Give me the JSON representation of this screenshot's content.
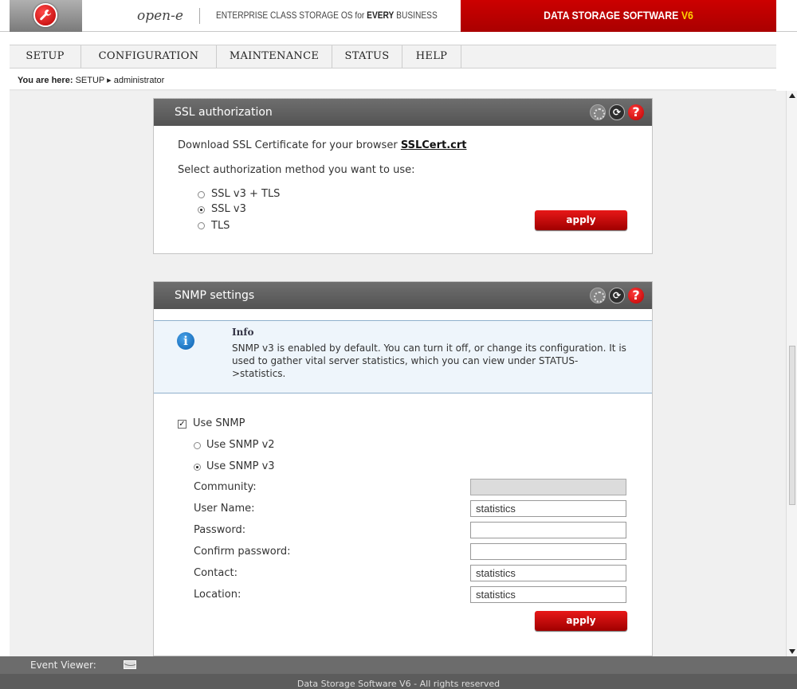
{
  "header": {
    "brand": "open-e",
    "tagline_prefix": "ENTERPRISE CLASS STORAGE OS for ",
    "tagline_bold": "EVERY",
    "tagline_suffix": " BUSINESS",
    "product_main": "DATA STORAGE SOFTWARE ",
    "product_version": "V6"
  },
  "nav": {
    "items": [
      {
        "label": "SETUP"
      },
      {
        "label": "CONFIGURATION"
      },
      {
        "label": "MAINTENANCE"
      },
      {
        "label": "STATUS"
      },
      {
        "label": "HELP"
      }
    ]
  },
  "breadcrumb": {
    "prefix": "You are here:",
    "first": "SETUP",
    "separator": "▸",
    "second": "administrator"
  },
  "ssl": {
    "title": "SSL authorization",
    "download_text": "Download SSL Certificate for your browser ",
    "cert_link": "SSLCert.crt",
    "select_text": "Select authorization method you want to use:",
    "options": [
      {
        "label": "SSL v3 + TLS",
        "selected": false
      },
      {
        "label": "SSL v3",
        "selected": true
      },
      {
        "label": "TLS",
        "selected": false
      }
    ],
    "apply_label": "apply"
  },
  "snmp": {
    "title": "SNMP settings",
    "info_title": "Info",
    "info_text": "SNMP v3 is enabled by default. You can turn it off, or change its configuration. It is used to gather vital server statistics, which you can view under STATUS->statistics.",
    "use_snmp_label": "Use SNMP",
    "use_snmp_checked": true,
    "versions": [
      {
        "label": "Use SNMP v2",
        "selected": false
      },
      {
        "label": "Use SNMP v3",
        "selected": true
      }
    ],
    "fields": [
      {
        "label": "Community:",
        "value": "",
        "disabled": true
      },
      {
        "label": "User Name:",
        "value": "statistics",
        "disabled": false
      },
      {
        "label": "Password:",
        "value": "",
        "disabled": false
      },
      {
        "label": "Confirm password:",
        "value": "",
        "disabled": false
      },
      {
        "label": "Contact:",
        "value": "statistics",
        "disabled": false
      },
      {
        "label": "Location:",
        "value": "statistics",
        "disabled": false
      }
    ],
    "apply_label": "apply"
  },
  "footer": {
    "event_viewer_label": "Event Viewer:",
    "copyright": "Data Storage Software V6 - All rights reserved"
  },
  "icons": {
    "logo": "wrench-icon",
    "panel_icons": [
      "loading-icon",
      "refresh-icon",
      "help-icon"
    ],
    "info": "info-icon",
    "event_viewer": "envelope-icon"
  },
  "colors": {
    "brand_red": "#c00000",
    "version_yellow": "#ffd400",
    "panel_header": "#5e5e5e",
    "info_bg": "#eef5fb"
  }
}
